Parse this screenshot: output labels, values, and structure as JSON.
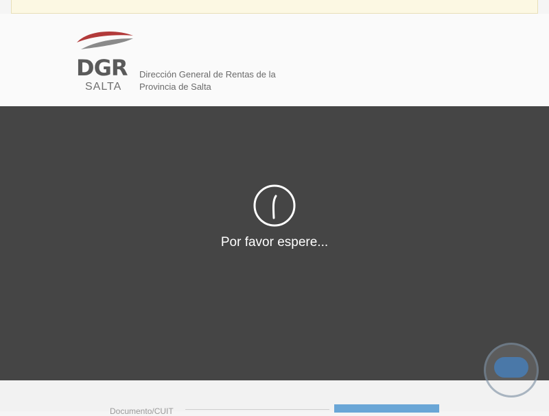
{
  "header": {
    "logo": {
      "icon_name": "dgr-salta-logo",
      "mark": "DGR",
      "subtitle": "SALTA",
      "colors": {
        "swoosh_red": "#b23a3a",
        "swoosh_gray": "#8a8a8a",
        "text": "#5a5a5a"
      }
    },
    "org_name_line1": "Dirección General de Rentas de la",
    "org_name_line2": "Provincia de Salta"
  },
  "loading": {
    "icon_name": "clock-spinner-icon",
    "message": "Por favor espere..."
  },
  "footer": {
    "field_label": "Documento/CUIT"
  },
  "chat": {
    "icon_name": "chat-bubble-icon"
  },
  "colors": {
    "overlay": "#454545",
    "notice_bar": "#fcf8e3",
    "button": "#6aa6d6"
  }
}
